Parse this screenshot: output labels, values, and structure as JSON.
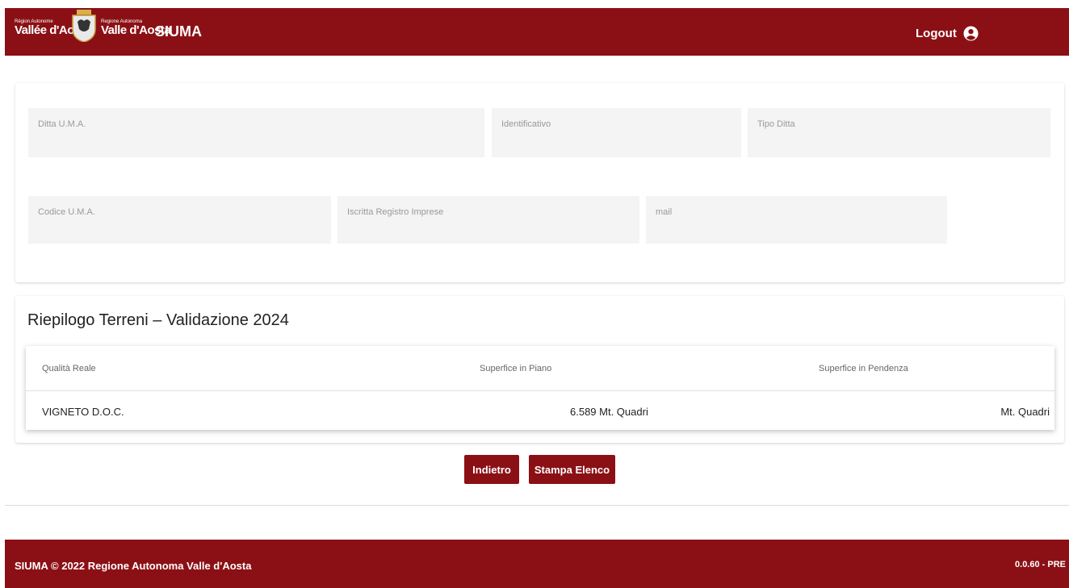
{
  "header": {
    "logo_left_small": "Région Autonome",
    "logo_left_big": "Vallée d'Aoste",
    "logo_right_small": "Regione Autonoma",
    "logo_right_big": "Valle d'Aosta",
    "app_title": "SIUMA",
    "logout_label": "Logout"
  },
  "form": {
    "ditta_label": "Ditta U.M.A.",
    "identificativo_label": "Identificativo",
    "tipo_ditta_label": "Tipo Ditta",
    "codice_label": "Codice U.M.A.",
    "registro_label": "Iscritta Registro Imprese",
    "mail_label": "mail"
  },
  "summary": {
    "title": "Riepilogo Terreni – Validazione 2024",
    "columns": [
      "Qualità Reale",
      "Superfice in Piano",
      "Superfice in Pendenza"
    ],
    "rows": [
      [
        "VIGNETO D.O.C.",
        "6.589 Mt. Quadri",
        "Mt. Quadri"
      ]
    ]
  },
  "buttons": {
    "back": "Indietro",
    "print": "Stampa Elenco"
  },
  "footer": {
    "copyright": "SIUMA © 2022 Regione Autonoma Valle d'Aosta",
    "version": "0.0.60 - PRE"
  },
  "colors": {
    "brand": "#8b1015"
  }
}
